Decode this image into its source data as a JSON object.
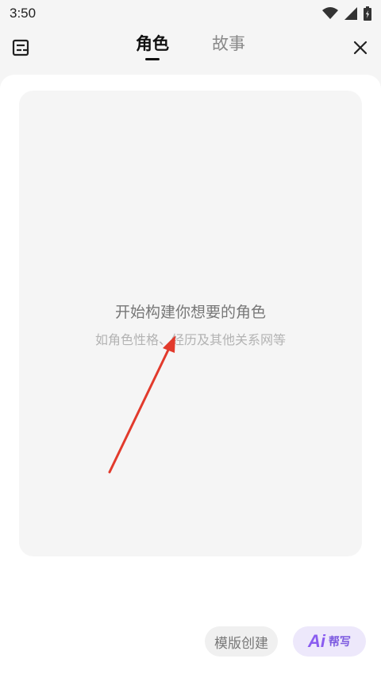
{
  "status_bar": {
    "time": "3:50",
    "icons": [
      "wifi-icon",
      "signal-icon",
      "battery-icon"
    ]
  },
  "header": {
    "menu_icon": "document-list-icon",
    "tabs": [
      {
        "label": "角色",
        "active": true
      },
      {
        "label": "故事",
        "active": false
      }
    ],
    "close_icon": "close-icon"
  },
  "empty_state": {
    "title": "开始构建你想要的角色",
    "subtitle": "如角色性格、经历及其他关系网等"
  },
  "actions": {
    "template_label": "模版创建",
    "ai_logo": "Ai",
    "ai_label": "帮写"
  },
  "colors": {
    "accent": "#8a5cf0",
    "arrow": "#e23a2c"
  }
}
